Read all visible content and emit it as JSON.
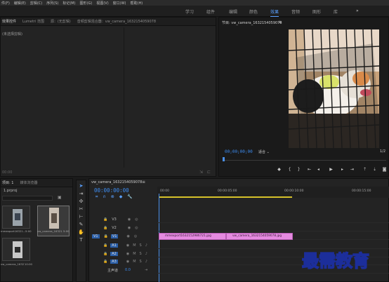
{
  "menubar": {
    "items": [
      "件(F)",
      "编辑(E)",
      "剪辑(C)",
      "序列(S)",
      "标记(M)",
      "图形(G)",
      "视图(V)",
      "窗口(W)",
      "帮助(H)"
    ]
  },
  "workspaces": {
    "items": [
      "学习",
      "组件",
      "编辑",
      "颜色",
      "效果",
      "音频",
      "图形",
      "库"
    ],
    "active": "效果",
    "more": "»"
  },
  "source_panel": {
    "tabs": [
      "效果控件",
      "Lumetri 范围",
      "源：(无剪辑)",
      "音频剪辑混合器：vw_camera_1632154059078"
    ],
    "message": "(未选择剪辑)",
    "timecode": "00:00"
  },
  "program_monitor": {
    "title": "节目: vw_camera_1632154059078",
    "menu_icon": "≡",
    "timecode": "00;00;00;00",
    "fit": "适合",
    "fraction": "1/2",
    "image_alt": "puppy-in-cage-image"
  },
  "project_panel": {
    "tabs": [
      "项目: 1",
      "媒体浏览器"
    ],
    "project_name": "1.prproj",
    "items": [
      {
        "name": "mmexport16321…",
        "duration": "5:00"
      },
      {
        "name": "vw_camera_1632154059078",
        "duration": "5:00"
      },
      {
        "name": "vw_camera_16321…",
        "duration": "10:00"
      }
    ]
  },
  "timeline": {
    "title": "vw_camera_1632154059078",
    "timecode": "00:00:00:00",
    "ruler": [
      "00:00",
      "00:00:05:00",
      "00:00:10:00",
      "00:00:15:00"
    ],
    "video_tracks": [
      "V3",
      "V2",
      "V1"
    ],
    "audio_tracks": [
      "A1",
      "A2",
      "A3"
    ],
    "master_label": "主声道",
    "master_value": "0.0",
    "source_patch": "V1",
    "clips": [
      {
        "name": "mmexport1632152986721.jpg",
        "track": "V1"
      },
      {
        "name": "vw_camera_1632154059078.jpg",
        "track": "V1"
      }
    ]
  },
  "watermark": "最需教育"
}
